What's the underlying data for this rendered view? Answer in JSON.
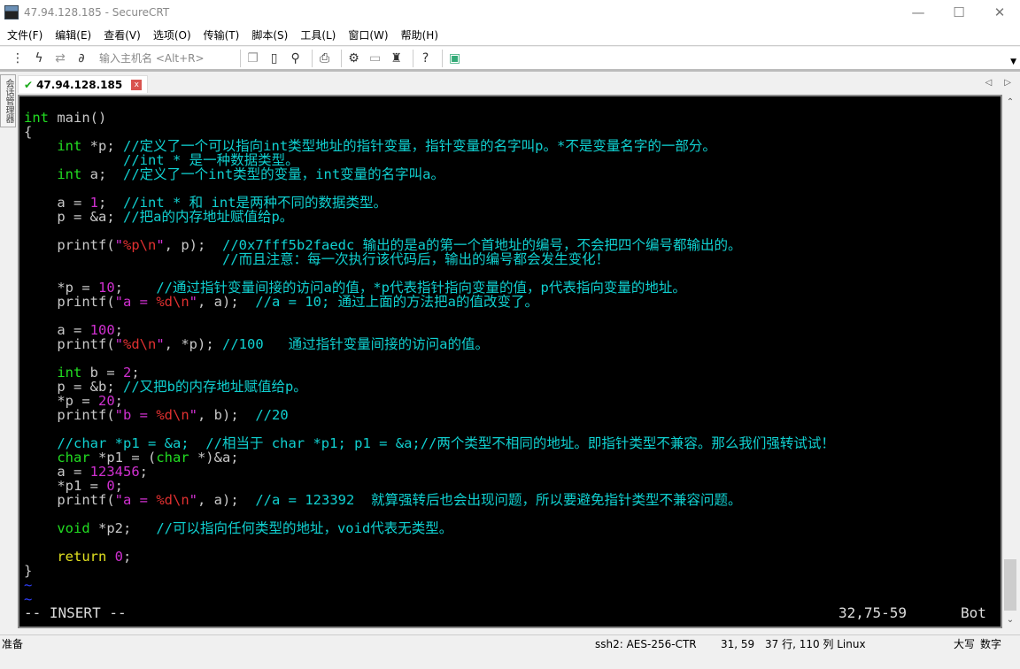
{
  "window": {
    "title": "47.94.128.185 - SecureCRT",
    "minimize": "—",
    "maximize": "☐",
    "close": "✕"
  },
  "menu": [
    "文件(F)",
    "编辑(E)",
    "查看(V)",
    "选项(O)",
    "传输(T)",
    "脚本(S)",
    "工具(L)",
    "窗口(W)",
    "帮助(H)"
  ],
  "toolbar": {
    "host_placeholder": "输入主机名 <Alt+R>",
    "icons": [
      "connect-bar-icon",
      "lightning-icon",
      "reconnect-icon",
      "disconnect-icon",
      "copy-icon",
      "paste-icon",
      "find-icon",
      "print-icon",
      "settings-icon",
      "keymap-icon",
      "key-icon",
      "help-icon",
      "sftp-icon"
    ]
  },
  "sidebar": {
    "label": "会话管理器"
  },
  "tab": {
    "label": "47.94.128.185",
    "close": "x",
    "prev": "◁",
    "next": "▷"
  },
  "terminal": {
    "lines": [
      [
        [
          "int",
          "type"
        ],
        [
          " main()",
          "def"
        ]
      ],
      [
        [
          "{",
          "def"
        ]
      ],
      [
        [
          "    ",
          "def"
        ],
        [
          "int",
          "type"
        ],
        [
          " *p; ",
          "def"
        ],
        [
          "//定义了一个可以指向int类型地址的指针变量，指针变量的名字叫p。*不是变量名字的一部分。",
          "com"
        ]
      ],
      [
        [
          "            //int * 是一种数据类型。",
          "com"
        ]
      ],
      [
        [
          "    ",
          "def"
        ],
        [
          "int",
          "type"
        ],
        [
          " a;  ",
          "def"
        ],
        [
          "//定义了一个int类型的变量，int变量的名字叫a。",
          "com"
        ]
      ],
      [],
      [
        [
          "    a = ",
          "def"
        ],
        [
          "1",
          "num"
        ],
        [
          ";  ",
          "def"
        ],
        [
          "//int * 和 int是两种不同的数据类型。",
          "com"
        ]
      ],
      [
        [
          "    p = &a; ",
          "def"
        ],
        [
          "//把a的内存地址赋值给p。",
          "com"
        ]
      ],
      [],
      [
        [
          "    printf(",
          "def"
        ],
        [
          "\"",
          "num"
        ],
        [
          "%p\\n",
          "str"
        ],
        [
          "\"",
          "num"
        ],
        [
          ", p);  ",
          "def"
        ],
        [
          "//0x7fff5b2faedc 输出的是a的第一个首地址的编号，不会把四个编号都输出的。",
          "com"
        ]
      ],
      [
        [
          "                        //而且注意：每一次执行该代码后，输出的编号都会发生变化！",
          "com"
        ]
      ],
      [],
      [
        [
          "    *p = ",
          "def"
        ],
        [
          "10",
          "num"
        ],
        [
          ";    ",
          "def"
        ],
        [
          "//通过指针变量间接的访问a的值，*p代表指针指向变量的值，p代表指向变量的地址。",
          "com"
        ]
      ],
      [
        [
          "    printf(",
          "def"
        ],
        [
          "\"a = ",
          "num"
        ],
        [
          "%d\\n",
          "str"
        ],
        [
          "\"",
          "num"
        ],
        [
          ", a);  ",
          "def"
        ],
        [
          "//a = 10; 通过上面的方法把a的值改变了。",
          "com"
        ]
      ],
      [],
      [
        [
          "    a = ",
          "def"
        ],
        [
          "100",
          "num"
        ],
        [
          ";",
          "def"
        ]
      ],
      [
        [
          "    printf(",
          "def"
        ],
        [
          "\"",
          "num"
        ],
        [
          "%d\\n",
          "str"
        ],
        [
          "\"",
          "num"
        ],
        [
          ", *p); ",
          "def"
        ],
        [
          "//100   通过指针变量间接的访问a的值。",
          "com"
        ]
      ],
      [],
      [
        [
          "    ",
          "def"
        ],
        [
          "int",
          "type"
        ],
        [
          " b = ",
          "def"
        ],
        [
          "2",
          "num"
        ],
        [
          ";",
          "def"
        ]
      ],
      [
        [
          "    p = &b; ",
          "def"
        ],
        [
          "//又把b的内存地址赋值给p。",
          "com"
        ]
      ],
      [
        [
          "    *p = ",
          "def"
        ],
        [
          "20",
          "num"
        ],
        [
          ";",
          "def"
        ]
      ],
      [
        [
          "    printf(",
          "def"
        ],
        [
          "\"b = ",
          "num"
        ],
        [
          "%d\\n",
          "str"
        ],
        [
          "\"",
          "num"
        ],
        [
          ", b);  ",
          "def"
        ],
        [
          "//20",
          "com"
        ]
      ],
      [],
      [
        [
          "    //char *p1 = &a;  //相当于 char *p1; p1 = &a;//两个类型不相同的地址。即指针类型不兼容。那么我们强转试试！",
          "com"
        ]
      ],
      [
        [
          "    ",
          "def"
        ],
        [
          "char",
          "type"
        ],
        [
          " *p1 = (",
          "def"
        ],
        [
          "char",
          "type"
        ],
        [
          " *)&a;",
          "def"
        ]
      ],
      [
        [
          "    a = ",
          "def"
        ],
        [
          "123456",
          "num"
        ],
        [
          ";",
          "def"
        ]
      ],
      [
        [
          "    *p1 = ",
          "def"
        ],
        [
          "0",
          "num"
        ],
        [
          ";",
          "def"
        ]
      ],
      [
        [
          "    printf(",
          "def"
        ],
        [
          "\"a = ",
          "num"
        ],
        [
          "%d\\n",
          "str"
        ],
        [
          "\"",
          "num"
        ],
        [
          ", a);  ",
          "def"
        ],
        [
          "//a = 123392  就算强转后也会出现问题，所以要避免指针类型不兼容问题。",
          "com"
        ]
      ],
      [],
      [
        [
          "    ",
          "def"
        ],
        [
          "void",
          "type"
        ],
        [
          " *p2;   ",
          "def"
        ],
        [
          "//可以指向任何类型的地址，void代表无类型。",
          "com"
        ]
      ],
      [],
      [
        [
          "    ",
          "def"
        ],
        [
          "return",
          "kw"
        ],
        [
          " ",
          "def"
        ],
        [
          "0",
          "num"
        ],
        [
          ";",
          "def"
        ]
      ],
      [
        [
          "}",
          "def"
        ]
      ],
      [
        [
          "~",
          "tilde"
        ]
      ],
      [
        [
          "~",
          "tilde"
        ]
      ]
    ],
    "mode": "-- INSERT --",
    "position": "32,75-59",
    "scroll_pos": "Bot",
    "colors": {
      "default": "#c8c8c8",
      "type": "#22dd22",
      "comment": "#10d0d0",
      "number": "#d030d0",
      "format": "#e03030",
      "keyword": "#e0e020",
      "tilde": "#3040ff",
      "background": "#000000"
    }
  },
  "statusbar": {
    "ready": "准备",
    "cipher": "ssh2: AES-256-CTR",
    "cursor": "31,  59",
    "size": "37 行, 110 列 Linux",
    "caps": "大写",
    "num": "数字"
  }
}
